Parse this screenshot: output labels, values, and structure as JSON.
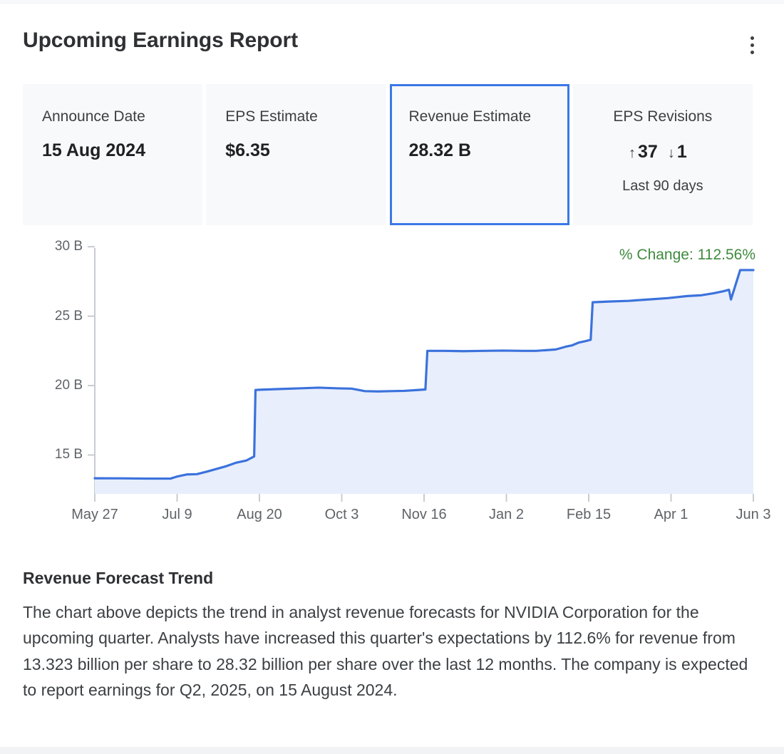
{
  "header": {
    "title": "Upcoming Earnings Report",
    "menu_icon": "kebab-menu-icon"
  },
  "stats": [
    {
      "label": "Announce Date",
      "value": "15 Aug 2024",
      "selected": false
    },
    {
      "label": "EPS Estimate",
      "value": "$6.35",
      "selected": false
    },
    {
      "label": "Revenue Estimate",
      "value": "28.32 B",
      "selected": true
    },
    {
      "label": "EPS Revisions",
      "up_arrow": "↑",
      "up_count": "37",
      "down_arrow": "↓",
      "down_count": "1",
      "sub": "Last 90 days",
      "selected": false
    }
  ],
  "chart_annotation": {
    "pct_change_label": "% Change: 112.56%",
    "pct_change_color": "#3f8a3f"
  },
  "colors": {
    "accent_blue": "#3b78e7",
    "line_blue": "#3b72dc",
    "area_fill": "#e8eefb",
    "card_bg": "#f8f9fa",
    "axis_gray": "#c8ccd0",
    "text_dark": "#2f3033",
    "text_muted": "#5f6368",
    "green": "#3f8a3f"
  },
  "chart_data": {
    "type": "area",
    "title": "Revenue Forecast Trend",
    "xlabel": "",
    "ylabel": "",
    "ylim": [
      12.2,
      29.6
    ],
    "xlim": [
      0,
      100
    ],
    "grid": false,
    "legend": "none",
    "ytick_labels": [
      "30 B",
      "25 B",
      "20 B",
      "15 B"
    ],
    "ytick_values": [
      30,
      25,
      20,
      15
    ],
    "xtick_labels": [
      "May 27",
      "Jul 9",
      "Aug 20",
      "Oct 3",
      "Nov 16",
      "Jan 2",
      "Feb 15",
      "Apr 1",
      "Jun 3"
    ],
    "xtick_positions": [
      0,
      12.5,
      25,
      37.5,
      50,
      62.5,
      75,
      87.5,
      100
    ],
    "series": [
      {
        "name": "Revenue Estimate",
        "units": "USD billions",
        "x": [
          0,
          4.0,
          8.0,
          11.5,
          12.5,
          14.0,
          15.5,
          17.0,
          18.5,
          20.0,
          21.5,
          23.0,
          24.2,
          24.4,
          25.0,
          28.0,
          31.0,
          34.0,
          37.0,
          39.0,
          41.0,
          43.0,
          45.0,
          47.0,
          49.0,
          50.2,
          50.5,
          53.0,
          56.0,
          59.0,
          62.0,
          65.0,
          67.0,
          68.5,
          70.0,
          71.5,
          72.5,
          73.5,
          74.5,
          75.3,
          75.6,
          78.0,
          81.0,
          84.0,
          87.0,
          90.0,
          92.0,
          94.0,
          95.5,
          96.3,
          96.6,
          98.0,
          100
        ],
        "y": [
          13.323,
          13.32,
          13.3,
          13.3,
          13.45,
          13.6,
          13.62,
          13.8,
          14.0,
          14.2,
          14.45,
          14.6,
          14.9,
          19.68,
          19.7,
          19.75,
          19.8,
          19.85,
          19.8,
          19.78,
          19.6,
          19.58,
          19.6,
          19.62,
          19.68,
          19.72,
          22.5,
          22.5,
          22.48,
          22.5,
          22.52,
          22.5,
          22.5,
          22.55,
          22.6,
          22.8,
          22.9,
          23.1,
          23.2,
          23.3,
          26.0,
          26.05,
          26.1,
          26.2,
          26.3,
          26.45,
          26.5,
          26.65,
          26.8,
          26.9,
          26.2,
          28.32,
          28.32
        ],
        "start_value": 13.323,
        "end_value": 28.32,
        "pct_change": 112.56,
        "line_color": "#3b72dc",
        "fill_color": "#e8eefb"
      }
    ]
  },
  "narrative": {
    "title": "Revenue Forecast Trend",
    "body": "The chart above depicts the trend in analyst revenue forecasts for NVIDIA Corporation for the upcoming quarter. Analysts have increased this quarter's expectations by 112.6% for revenue from 13.323 billion per share to 28.32 billion per share over the last 12 months. The company is expected to report earnings for Q2, 2025, on 15 August 2024."
  }
}
